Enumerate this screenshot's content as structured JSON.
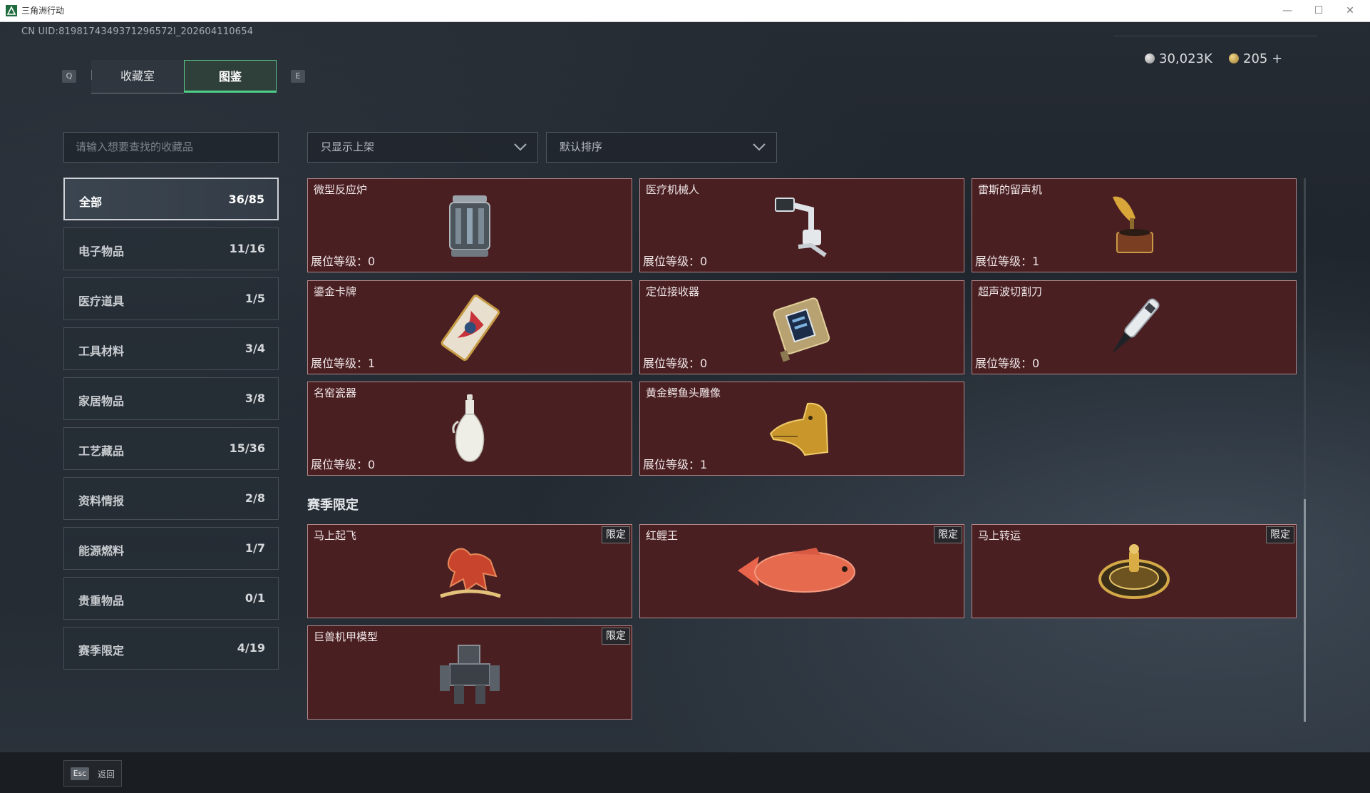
{
  "window": {
    "title": "三角洲行动",
    "min": "—",
    "max": "☐",
    "close": "✕"
  },
  "uid": "CN UID:8198174349371296572l_202604110654",
  "tabs": {
    "prev_key": "Q",
    "next_key": "E",
    "items": [
      {
        "label": "收藏室"
      },
      {
        "label": "图鉴"
      }
    ]
  },
  "currency": {
    "silver": "30,023K",
    "gold": "205",
    "add": "+"
  },
  "search": {
    "placeholder": "请输入想要查找的收藏品"
  },
  "categories": [
    {
      "label": "全部",
      "count": "36/85"
    },
    {
      "label": "电子物品",
      "count": "11/16"
    },
    {
      "label": "医疗道具",
      "count": "1/5"
    },
    {
      "label": "工具材料",
      "count": "3/4"
    },
    {
      "label": "家居物品",
      "count": "3/8"
    },
    {
      "label": "工艺藏品",
      "count": "15/36"
    },
    {
      "label": "资料情报",
      "count": "2/8"
    },
    {
      "label": "能源燃料",
      "count": "1/7"
    },
    {
      "label": "贵重物品",
      "count": "0/1"
    },
    {
      "label": "赛季限定",
      "count": "4/19"
    }
  ],
  "filters": {
    "display": "只显示上架",
    "sort": "默认排序"
  },
  "items": [
    {
      "name": "微型反应炉",
      "level": "展位等级：0",
      "icon": "reactor-icon"
    },
    {
      "name": "医疗机械人",
      "level": "展位等级：0",
      "icon": "medical-robot-icon"
    },
    {
      "name": "雷斯的留声机",
      "level": "展位等级：1",
      "icon": "gramophone-icon"
    },
    {
      "name": "鎏金卡牌",
      "level": "展位等级：1",
      "icon": "card-icon"
    },
    {
      "name": "定位接收器",
      "level": "展位等级：0",
      "icon": "receiver-icon"
    },
    {
      "name": "超声波切割刀",
      "level": "展位等级：0",
      "icon": "cutter-icon"
    },
    {
      "name": "名窑瓷器",
      "level": "展位等级：0",
      "icon": "vase-icon"
    },
    {
      "name": "黄金鳄鱼头雕像",
      "level": "展位等级：1",
      "icon": "crocodile-statue-icon"
    }
  ],
  "season_section": {
    "title": "赛季限定"
  },
  "season_items": [
    {
      "name": "马上起飞",
      "tag": "限定",
      "icon": "horse-icon"
    },
    {
      "name": "红鲤王",
      "tag": "限定",
      "icon": "carp-icon"
    },
    {
      "name": "马上转运",
      "tag": "限定",
      "icon": "wheel-icon"
    },
    {
      "name": "巨兽机甲模型",
      "tag": "限定",
      "icon": "mech-icon"
    }
  ],
  "footer": {
    "key": "Esc",
    "label": "返回"
  }
}
